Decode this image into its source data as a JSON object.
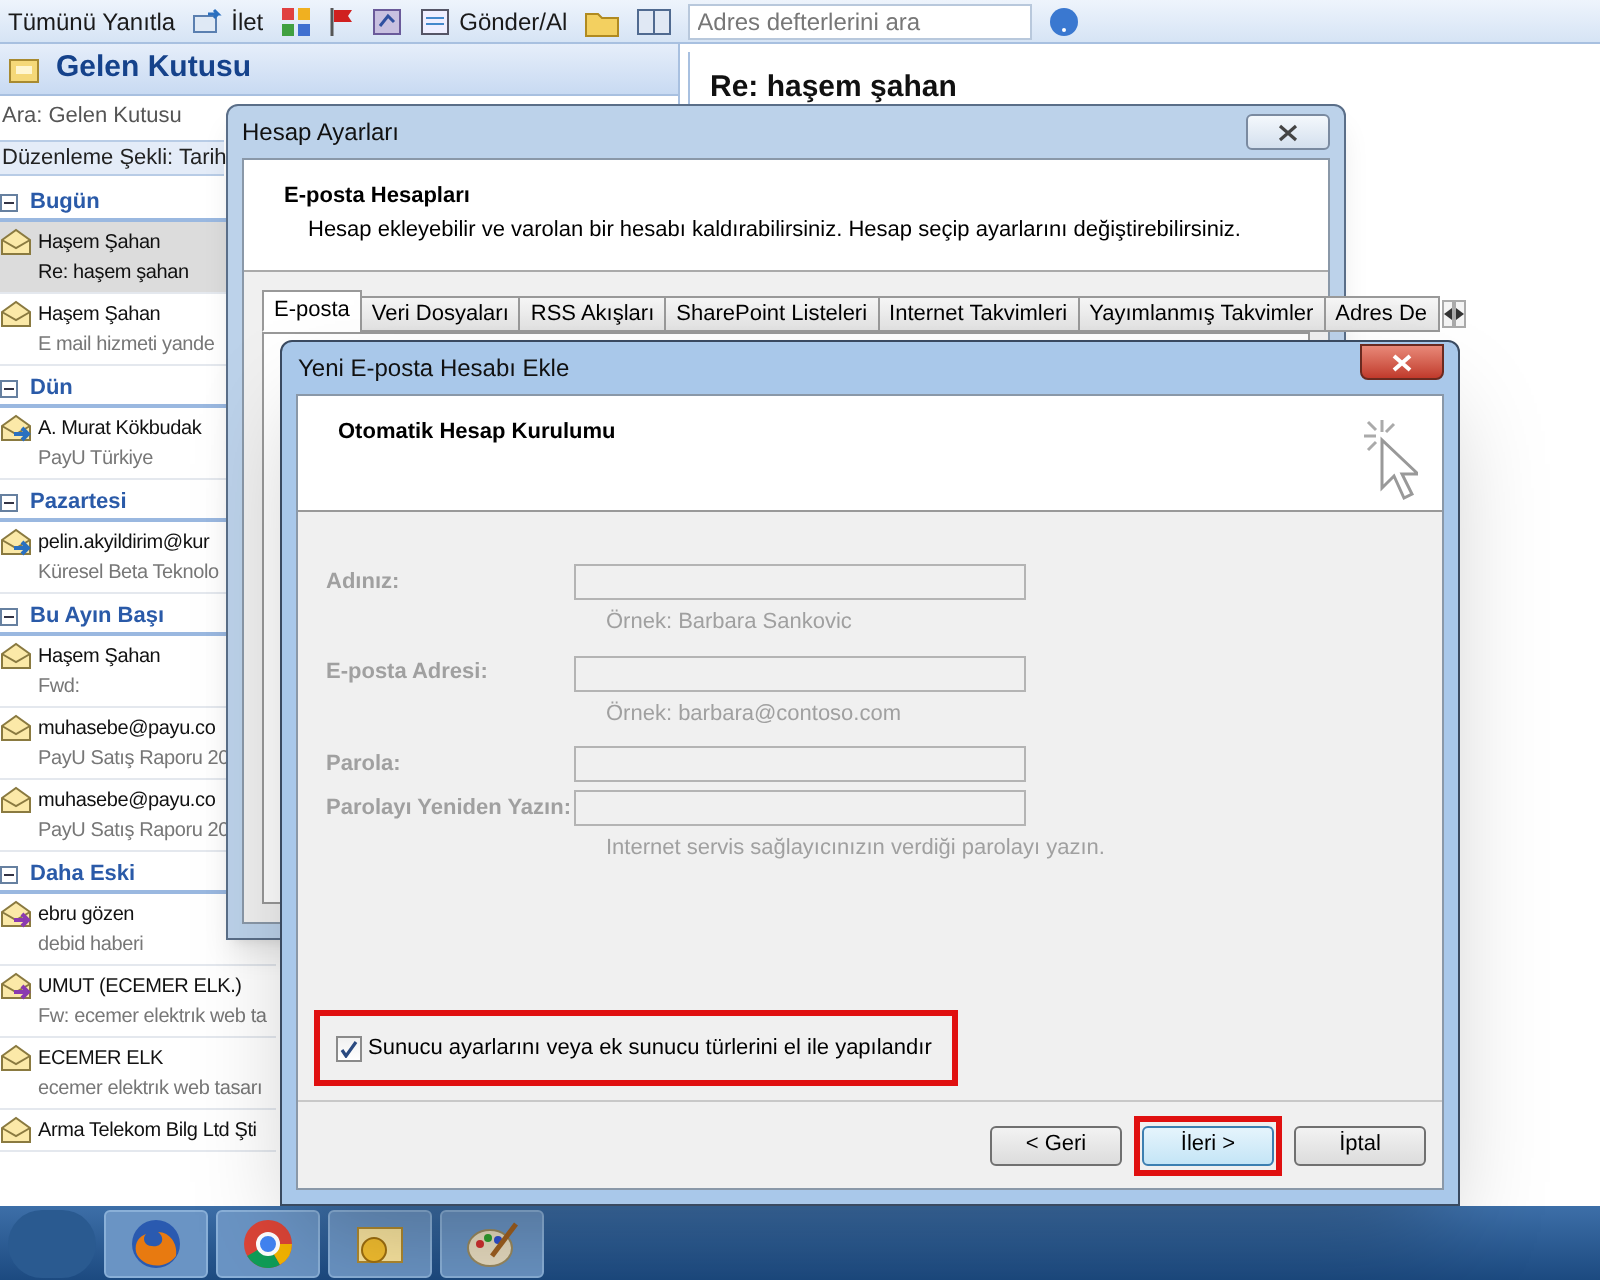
{
  "toolbar": {
    "items": [
      {
        "kind": "reply_all",
        "label": "Tümünü Yanıtla"
      },
      {
        "kind": "forward",
        "label": "İlet"
      },
      {
        "kind": "categories"
      },
      {
        "kind": "flag"
      },
      {
        "kind": "rules"
      },
      {
        "kind": "send_receive",
        "label": "Gönder/Al"
      },
      {
        "kind": "folder"
      },
      {
        "kind": "address_book"
      }
    ],
    "search": {
      "placeholder": "Adres defterlerini ara"
    }
  },
  "folder": {
    "title": "Gelen Kutusu",
    "search": {
      "placeholder": "Ara: Gelen Kutusu"
    },
    "arrange": "Düzenleme Şekli: Tarih",
    "groups": [
      {
        "title": "Bugün",
        "expanded": true,
        "items": [
          {
            "sender": "Haşem Şahan",
            "subject": "Re: haşem şahan",
            "kind": "read",
            "selected": true
          },
          {
            "sender": "Haşem Şahan",
            "subject": "E mail hizmeti yande",
            "kind": "read",
            "selected": false
          }
        ]
      },
      {
        "title": "Dün",
        "expanded": true,
        "items": [
          {
            "sender": "A. Murat Kökbudak",
            "subject": "PayU Türkiye",
            "kind": "replied",
            "selected": false
          }
        ]
      },
      {
        "title": "Pazartesi",
        "expanded": true,
        "items": [
          {
            "sender": "pelin.akyildirim@kur",
            "subject": "Küresel Beta Teknolo",
            "kind": "replied",
            "selected": false
          }
        ]
      },
      {
        "title": "Bu Ayın Başı",
        "expanded": true,
        "items": [
          {
            "sender": "Haşem Şahan",
            "subject": "Fwd:",
            "kind": "read",
            "selected": false
          },
          {
            "sender": "muhasebe@payu.co",
            "subject": "PayU Satış Raporu 20",
            "kind": "read",
            "selected": false
          },
          {
            "sender": "muhasebe@payu.co",
            "subject": "PayU Satış Raporu 20",
            "kind": "read",
            "selected": false
          }
        ]
      },
      {
        "title": "Daha Eski",
        "expanded": true,
        "items": [
          {
            "sender": "ebru gözen",
            "subject": "debid haberi",
            "kind": "forwarded",
            "selected": false
          },
          {
            "sender": "UMUT (ECEMER ELK.)",
            "subject": "Fw: ecemer elektrık web ta",
            "kind": "forwarded",
            "selected": false
          },
          {
            "sender": "ECEMER ELK",
            "subject": "ecemer elektrık web tasarı",
            "kind": "read",
            "selected": false
          },
          {
            "sender": "Arma Telekom Bilg Ltd Şti",
            "kind": "read",
            "selected": false
          }
        ]
      }
    ]
  },
  "reading_pane": {
    "subject": "Re: haşem şahan"
  },
  "account_settings": {
    "title": "Hesap Ayarları",
    "heading": "E-posta Hesapları",
    "description": "Hesap ekleyebilir ve varolan bir hesabı kaldırabilirsiniz. Hesap seçip ayarlarını değiştirebilirsiniz.",
    "tabs": [
      {
        "label": "E-posta",
        "selected": true
      },
      {
        "label": "Veri Dosyaları",
        "selected": false
      },
      {
        "label": "RSS Akışları",
        "selected": false
      },
      {
        "label": "SharePoint Listeleri",
        "selected": false
      },
      {
        "label": "Internet Takvimleri",
        "selected": false
      },
      {
        "label": "Yayımlanmış Takvimler",
        "selected": false
      },
      {
        "label": "Adres De",
        "selected": false
      }
    ]
  },
  "add_account": {
    "title": "Yeni E-posta Hesabı Ekle",
    "heading": "Otomatik Hesap Kurulumu",
    "disabled": true,
    "fields": [
      {
        "label": "Adınız:",
        "hint": "Örnek: Barbara Sankovic"
      },
      {
        "label": "E-posta Adresi:",
        "hint": "Örnek: barbara@contoso.com"
      },
      {
        "label": "Parola:"
      },
      {
        "label": "Parolayı Yeniden Yazın:",
        "hint": "Internet servis sağlayıcınızın verdiği parolayı yazın."
      }
    ],
    "manual_setup": {
      "label": "Sunucu ayarlarını veya ek sunucu türlerini el ile yapılandır",
      "checked": true,
      "highlighted": true
    },
    "buttons": [
      {
        "label": "< Geri",
        "highlighted": false,
        "default": false
      },
      {
        "label": "İleri >",
        "highlighted": true,
        "default": true
      },
      {
        "label": "İptal",
        "highlighted": false,
        "default": false
      }
    ]
  },
  "taskbar": {
    "apps": [
      {
        "kind": "browser_fox"
      },
      {
        "kind": "browser_circle"
      },
      {
        "kind": "mail"
      },
      {
        "kind": "paint"
      }
    ]
  }
}
